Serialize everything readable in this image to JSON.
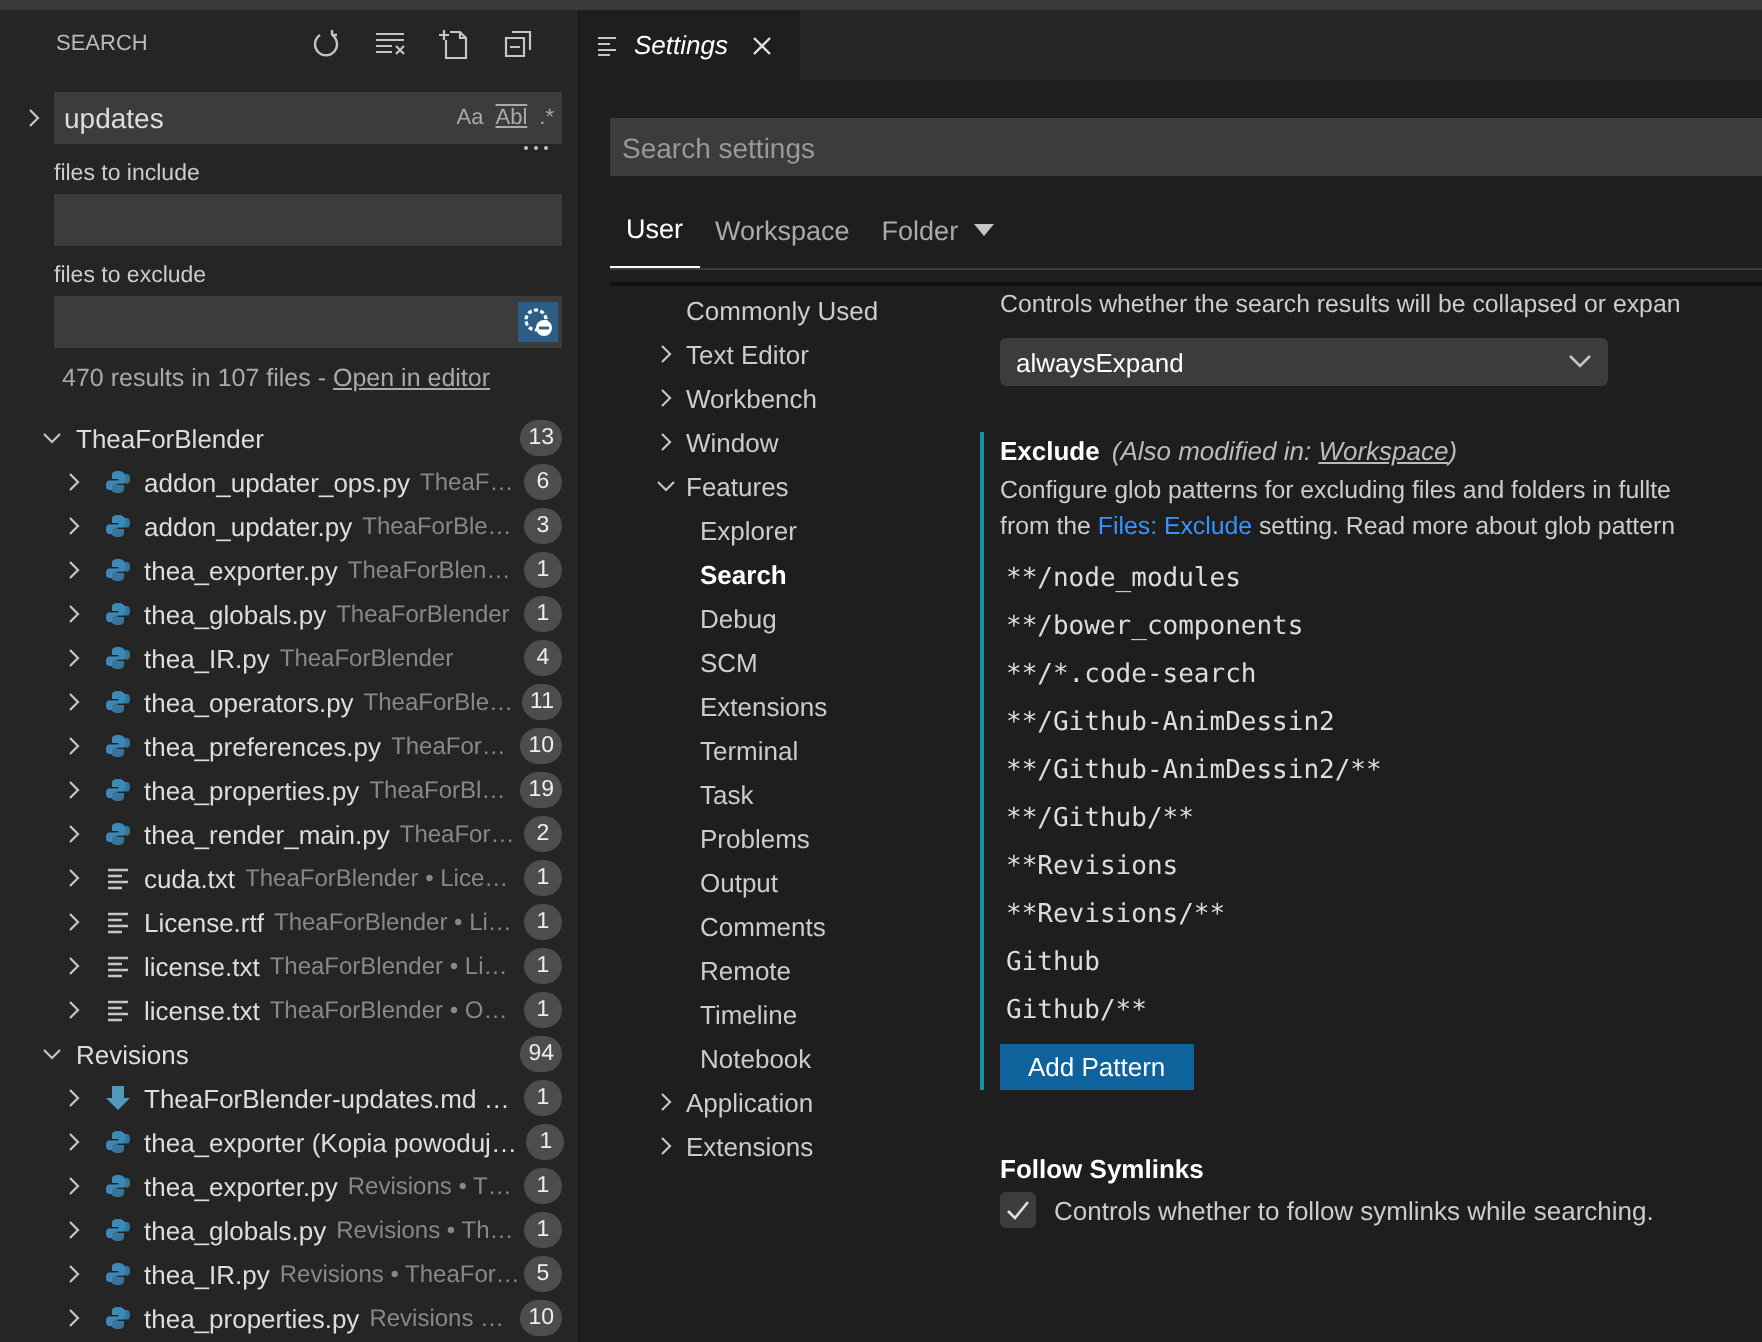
{
  "sidebar": {
    "title": "SEARCH",
    "query": {
      "value": "updates",
      "options": [
        "Aa",
        "Abl",
        ".*"
      ]
    },
    "include": {
      "label": "files to include"
    },
    "exclude": {
      "label": "files to exclude",
      "use_exclude_settings": true
    },
    "summary": {
      "text": "470 results in 107 files - ",
      "link": "Open in editor"
    },
    "groups": [
      {
        "name": "TheaForBlender",
        "count": "13",
        "expanded": true,
        "files": [
          {
            "kind": "python",
            "name": "addon_updater_ops.py",
            "path": "TheaF…",
            "count": "6"
          },
          {
            "kind": "python",
            "name": "addon_updater.py",
            "path": "TheaForBle…",
            "count": "3"
          },
          {
            "kind": "python",
            "name": "thea_exporter.py",
            "path": "TheaForBlen…",
            "count": "1"
          },
          {
            "kind": "python",
            "name": "thea_globals.py",
            "path": "TheaForBlender",
            "count": "1"
          },
          {
            "kind": "python",
            "name": "thea_IR.py",
            "path": "TheaForBlender",
            "count": "4"
          },
          {
            "kind": "python",
            "name": "thea_operators.py",
            "path": "TheaForBle…",
            "count": "11"
          },
          {
            "kind": "python",
            "name": "thea_preferences.py",
            "path": "TheaFor…",
            "count": "10"
          },
          {
            "kind": "python",
            "name": "thea_properties.py",
            "path": "TheaForBl…",
            "count": "19"
          },
          {
            "kind": "python",
            "name": "thea_render_main.py",
            "path": "TheaFor…",
            "count": "2"
          },
          {
            "kind": "text",
            "name": "cuda.txt",
            "path": "TheaForBlender • Lice…",
            "count": "1"
          },
          {
            "kind": "text",
            "name": "License.rtf",
            "path": "TheaForBlender • Li…",
            "count": "1"
          },
          {
            "kind": "text",
            "name": "license.txt",
            "path": "TheaForBlender • Li…",
            "count": "1"
          },
          {
            "kind": "text",
            "name": "license.txt",
            "path": "TheaForBlender • O…",
            "count": "1"
          }
        ]
      },
      {
        "name": "Revisions",
        "count": "94",
        "expanded": true,
        "files": [
          {
            "kind": "markdown",
            "name": "TheaForBlender-updates.md …",
            "count": "1"
          },
          {
            "kind": "python",
            "name": "thea_exporter (Kopia powoduj…",
            "count": "1"
          },
          {
            "kind": "python",
            "name": "thea_exporter.py",
            "path": "Revisions • T…",
            "count": "1"
          },
          {
            "kind": "python",
            "name": "thea_globals.py",
            "path": "Revisions • Th…",
            "count": "1"
          },
          {
            "kind": "python",
            "name": "thea_IR.py",
            "path": "Revisions • TheaFor…",
            "count": "5"
          },
          {
            "kind": "python",
            "name": "thea_properties.py",
            "path": "Revisions …",
            "count": "10"
          }
        ]
      }
    ]
  },
  "editor_tab": {
    "title": "Settings"
  },
  "settings": {
    "search": {
      "placeholder": "Search settings"
    },
    "tabs": [
      {
        "label": "User",
        "selected": true,
        "dropdown": false
      },
      {
        "label": "Workspace",
        "selected": false,
        "dropdown": false
      },
      {
        "label": "Folder",
        "selected": false,
        "dropdown": true
      }
    ],
    "nav": [
      {
        "label": "Commonly Used",
        "selected": false,
        "kind": "leaf"
      },
      {
        "label": "Text Editor",
        "selected": false,
        "kind": "group",
        "expanded": false
      },
      {
        "label": "Workbench",
        "selected": false,
        "kind": "group",
        "expanded": false
      },
      {
        "label": "Window",
        "selected": false,
        "kind": "group",
        "expanded": false
      },
      {
        "label": "Features",
        "selected": false,
        "kind": "group",
        "expanded": true,
        "children": [
          {
            "label": "Explorer",
            "selected": false
          },
          {
            "label": "Search",
            "selected": true
          },
          {
            "label": "Debug",
            "selected": false
          },
          {
            "label": "SCM",
            "selected": false
          },
          {
            "label": "Extensions",
            "selected": false
          },
          {
            "label": "Terminal",
            "selected": false
          },
          {
            "label": "Task",
            "selected": false
          },
          {
            "label": "Problems",
            "selected": false
          },
          {
            "label": "Output",
            "selected": false
          },
          {
            "label": "Comments",
            "selected": false
          },
          {
            "label": "Remote",
            "selected": false
          },
          {
            "label": "Timeline",
            "selected": false
          },
          {
            "label": "Notebook",
            "selected": false
          }
        ]
      },
      {
        "label": "Application",
        "selected": false,
        "kind": "group",
        "expanded": false
      },
      {
        "label": "Extensions",
        "selected": false,
        "kind": "group",
        "expanded": false
      }
    ],
    "collapse_setting": {
      "description": "Controls whether the search results will be collapsed or expan",
      "value": "alwaysExpand"
    },
    "exclude": {
      "title": "Exclude",
      "modified_prefix": "(Also modified in: ",
      "modified_link": "Workspace",
      "modified_suffix": ")",
      "description_1": "Configure glob patterns for excluding files and folders in fullte",
      "description_2": {
        "before": "from the ",
        "link": "Files: Exclude",
        "after": " setting. Read more about glob pattern"
      },
      "patterns": [
        "**/node_modules",
        "**/bower_components",
        "**/*.code-search",
        "**/Github-AnimDessin2",
        "**/Github-AnimDessin2/**",
        "**/Github/**",
        "**Revisions",
        "**Revisions/**",
        "Github",
        "Github/**"
      ],
      "add_button": "Add Pattern"
    },
    "symlinks": {
      "title": "Follow Symlinks",
      "description": "Controls whether to follow symlinks while searching.",
      "checked": true
    }
  }
}
